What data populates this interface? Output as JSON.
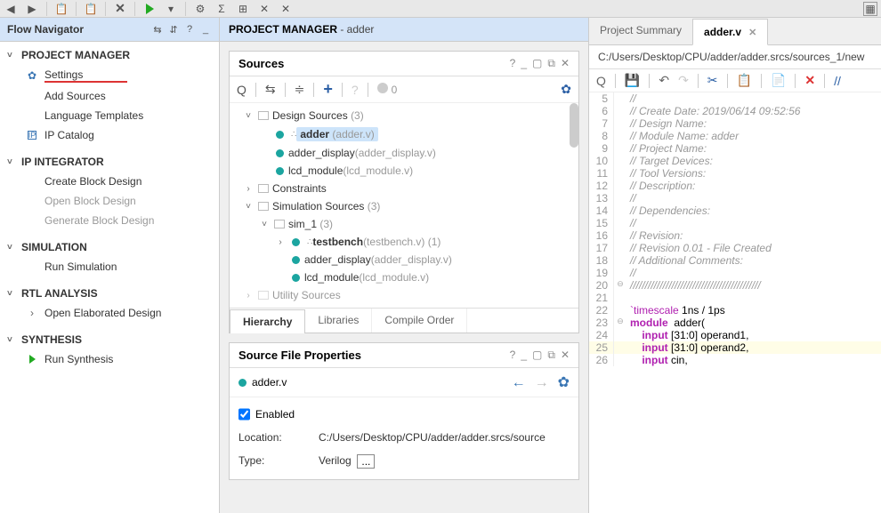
{
  "titles": {
    "flow_navigator": "Flow Navigator",
    "project_manager": "PROJECT MANAGER",
    "pm_suffix": " - adder",
    "sources_panel": "Sources",
    "source_props": "Source File Properties",
    "summary_tab": "Project Summary",
    "editor_tab": "adder.v"
  },
  "breadcrumb_path": "C:/Users/Desktop/CPU/adder/adder.srcs/sources_1/new",
  "nav": {
    "pm": {
      "label": "PROJECT MANAGER",
      "settings": "Settings",
      "add_sources": "Add Sources",
      "lang_templates": "Language Templates",
      "ip_catalog": "IP Catalog"
    },
    "ipint": {
      "label": "IP INTEGRATOR",
      "create": "Create Block Design",
      "open": "Open Block Design",
      "gen": "Generate Block Design"
    },
    "sim": {
      "label": "SIMULATION",
      "run": "Run Simulation"
    },
    "rtl": {
      "label": "RTL ANALYSIS",
      "open_elab": "Open Elaborated Design"
    },
    "syn": {
      "label": "SYNTHESIS",
      "run": "Run Synthesis"
    }
  },
  "sources_toolbar": {
    "zero": "0"
  },
  "tree": {
    "design_sources": "Design Sources",
    "ds_count": "(3)",
    "adder": "adder",
    "adder_paren": " (adder.v)",
    "adder_display": "adder_display",
    "adder_display_paren": " (adder_display.v)",
    "lcd": "lcd_module",
    "lcd_paren": " (lcd_module.v)",
    "constraints": "Constraints",
    "sim_sources": "Simulation Sources",
    "ss_count": "(3)",
    "sim_1": "sim_1",
    "sim_1_count": "(3)",
    "testbench": "testbench",
    "testbench_paren": " (testbench.v) (1)",
    "utility": "Utility Sources"
  },
  "tabs": {
    "hierarchy": "Hierarchy",
    "libraries": "Libraries",
    "compile_order": "Compile Order"
  },
  "props": {
    "file": "adder.v",
    "enabled": "Enabled",
    "location": "Location:",
    "location_val": "C:/Users/Desktop/CPU/adder/adder.srcs/source",
    "type": "Type:",
    "type_val": "Verilog"
  },
  "code": [
    {
      "n": 5,
      "t": "//",
      "cls": "cmt"
    },
    {
      "n": 6,
      "t": "// Create Date: 2019/06/14 09:52:56",
      "cls": "cmt"
    },
    {
      "n": 7,
      "t": "// Design Name:",
      "cls": "cmt"
    },
    {
      "n": 8,
      "t": "// Module Name: adder",
      "cls": "cmt"
    },
    {
      "n": 9,
      "t": "// Project Name:",
      "cls": "cmt"
    },
    {
      "n": 10,
      "t": "// Target Devices:",
      "cls": "cmt"
    },
    {
      "n": 11,
      "t": "// Tool Versions:",
      "cls": "cmt"
    },
    {
      "n": 12,
      "t": "// Description:",
      "cls": "cmt"
    },
    {
      "n": 13,
      "t": "//",
      "cls": "cmt"
    },
    {
      "n": 14,
      "t": "// Dependencies:",
      "cls": "cmt"
    },
    {
      "n": 15,
      "t": "//",
      "cls": "cmt"
    },
    {
      "n": 16,
      "t": "// Revision:",
      "cls": "cmt"
    },
    {
      "n": 17,
      "t": "// Revision 0.01 - File Created",
      "cls": "cmt"
    },
    {
      "n": 18,
      "t": "// Additional Comments:",
      "cls": "cmt"
    },
    {
      "n": 19,
      "t": "//",
      "cls": "cmt"
    },
    {
      "n": 20,
      "t": "////////////////////////////////////////////",
      "cls": "cmt",
      "fold": "⊖"
    },
    {
      "n": 21,
      "t": ""
    },
    {
      "n": 22,
      "html": "<span class='dir'>`timescale</span> 1ns / 1ps"
    },
    {
      "n": 23,
      "html": "<span class='kw'>module</span>  adder(",
      "fold": "⊖"
    },
    {
      "n": 24,
      "html": "    <span class='kw'>input</span> [31:0] operand1,"
    },
    {
      "n": 25,
      "html": "    <span class='kw'>input</span> [31:0] operand2,",
      "hl": true
    },
    {
      "n": 26,
      "html": "    <span class='kw'>input</span> cin,"
    }
  ]
}
